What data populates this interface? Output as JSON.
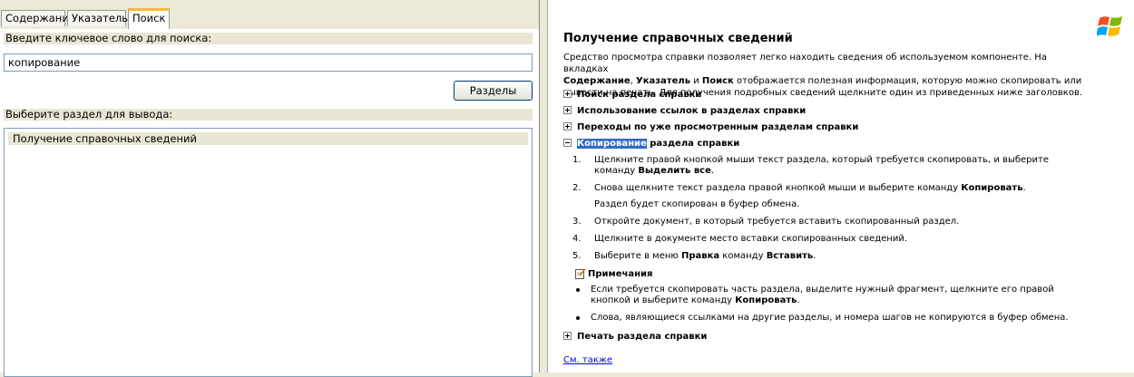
{
  "tabs": {
    "contents": "Содержание",
    "index": "Указатель",
    "search": "Поиск"
  },
  "search": {
    "keyword_label": "Введите ключевое слово для поиска:",
    "keyword_value": "копирование",
    "topics_button": "Разделы",
    "select_label": "Выберите раздел для вывода:",
    "results": [
      "Получение справочных сведений"
    ]
  },
  "article": {
    "title": "Получение справочных сведений",
    "intro_1": "Средство просмотра справки позволяет легко находить сведения об используемом компоненте. На вкладках",
    "intro_b1": "Содержание",
    "intro_sep1": ", ",
    "intro_b2": "Указатель",
    "intro_sep2": " и ",
    "intro_b3": "Поиск",
    "intro_2": " отображается полезная информация, которую можно скопировать или вывести на печать. Для получения подробных сведений щелкните один из приведенных ниже заголовков.",
    "sections": {
      "find": "Поиск раздела справки",
      "links": "Использование ссылок в разделах справки",
      "history": "Переходы по уже просмотренным разделам справки",
      "copy_hl": "Копирование",
      "copy_rest": " раздела справки",
      "print": "Печать раздела справки"
    },
    "steps": {
      "s1_num": "1.",
      "s1_text": "Щелкните правой кнопкой мыши текст раздела, который требуется скопировать, и выберите команду ",
      "s1_bold": "Выделить все",
      "s1_end": ".",
      "s2_num": "2.",
      "s2_text": "Снова щелкните текст раздела правой кнопкой мыши и выберите команду ",
      "s2_bold": "Копировать",
      "s2_end": ".",
      "s2_sub": "Раздел будет скопирован в буфер обмена.",
      "s3_num": "3.",
      "s3_text": "Откройте документ, в который требуется вставить скопированный раздел.",
      "s4_num": "4.",
      "s4_text": "Щелкните в документе место вставки скопированных сведений.",
      "s5_num": "5.",
      "s5_text1": "Выберите в меню ",
      "s5_bold1": "Правка",
      "s5_text2": " команду ",
      "s5_bold2": "Вставить",
      "s5_end": "."
    },
    "notes": {
      "heading": "Примечания",
      "n1_text": "Если требуется скопировать часть раздела, выделите нужный фрагмент, щелкните его правой кнопкой и выберите команду ",
      "n1_bold": "Копировать",
      "n1_end": ".",
      "n2_text": "Слова, являющиеся ссылками на другие разделы, и номера шагов не копируются в буфер обмена."
    },
    "see_also": "См. также"
  }
}
